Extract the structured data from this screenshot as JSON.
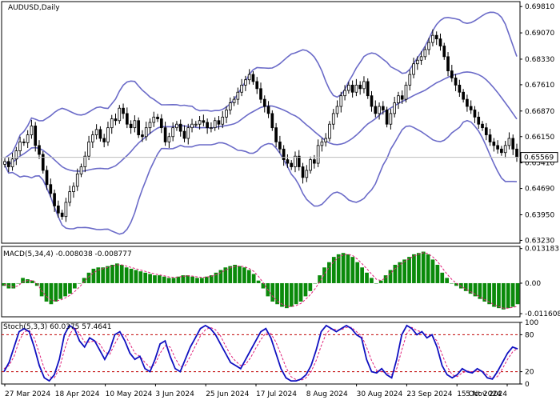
{
  "window_title": "AUDUSD,Daily",
  "colors": {
    "up": "#000000",
    "down": "#000000",
    "bollinger": "#6b6bc8",
    "macd_hist": "#0a8a0a",
    "macd_signal": "#e0207a",
    "stoch_main": "#1010c0",
    "stoch_signal": "#e0207a",
    "grid_level": "#c00000",
    "price_line": "#bdbdbd"
  },
  "chart_data": [
    {
      "type": "candlestick",
      "title": "AUDUSD,Daily",
      "panel": "main",
      "ylim": [
        0.6315,
        0.6995
      ],
      "y_ticks": [
        "0.69810",
        "0.69070",
        "0.68330",
        "0.67610",
        "0.66870",
        "0.66150",
        "0.65410",
        "0.64690",
        "0.63950",
        "0.63230"
      ],
      "current_price": "0.65569",
      "closes": [
        0.6545,
        0.653,
        0.6552,
        0.6575,
        0.66,
        0.6598,
        0.662,
        0.6645,
        0.659,
        0.6565,
        0.652,
        0.648,
        0.6455,
        0.642,
        0.64,
        0.639,
        0.643,
        0.646,
        0.6475,
        0.651,
        0.653,
        0.656,
        0.66,
        0.662,
        0.6635,
        0.661,
        0.66,
        0.664,
        0.6665,
        0.666,
        0.6695,
        0.668,
        0.665,
        0.664,
        0.666,
        0.662,
        0.6615,
        0.664,
        0.6655,
        0.667,
        0.6665,
        0.664,
        0.66,
        0.6615,
        0.664,
        0.665,
        0.663,
        0.661,
        0.664,
        0.665,
        0.665,
        0.666,
        0.6655,
        0.664,
        0.664,
        0.666,
        0.665,
        0.667,
        0.669,
        0.671,
        0.672,
        0.674,
        0.676,
        0.6775,
        0.679,
        0.677,
        0.675,
        0.672,
        0.67,
        0.668,
        0.664,
        0.66,
        0.658,
        0.655,
        0.654,
        0.653,
        0.656,
        0.653,
        0.65,
        0.652,
        0.655,
        0.654,
        0.659,
        0.66,
        0.661,
        0.665,
        0.668,
        0.67,
        0.673,
        0.6745,
        0.676,
        0.674,
        0.676,
        0.675,
        0.677,
        0.673,
        0.67,
        0.668,
        0.67,
        0.669,
        0.665,
        0.668,
        0.671,
        0.673,
        0.672,
        0.676,
        0.679,
        0.682,
        0.683,
        0.684,
        0.686,
        0.688,
        0.69,
        0.689,
        0.687,
        0.684,
        0.68,
        0.678,
        0.676,
        0.674,
        0.672,
        0.67,
        0.669,
        0.667,
        0.665,
        0.664,
        0.662,
        0.66,
        0.659,
        0.658,
        0.657,
        0.659,
        0.661,
        0.658,
        0.6557
      ],
      "x_labels": [
        "27 Mar 2024",
        "18 Apr 2024",
        "10 May 2024",
        "3 Jun 2024",
        "25 Jun 2024",
        "17 Jul 2024",
        "8 Aug 2024",
        "30 Aug 2024",
        "23 Sep 2024",
        "15 Oct 2024",
        "5 Nov 2024"
      ]
    },
    {
      "type": "bar",
      "title": "MACD(5,34,4) -0.008038 -0.008777",
      "panel": "macd",
      "ylim": [
        -0.0128,
        0.014
      ],
      "y_ticks": [
        "0.013183",
        "0.00",
        "-0.011608"
      ],
      "values": [
        -0.001,
        -0.002,
        -0.002,
        0.0,
        0.002,
        0.0015,
        0.001,
        -0.001,
        -0.005,
        -0.007,
        -0.008,
        -0.007,
        -0.006,
        -0.005,
        -0.004,
        -0.002,
        0.0,
        0.002,
        0.004,
        0.0055,
        0.006,
        0.006,
        0.0065,
        0.007,
        0.0075,
        0.007,
        0.006,
        0.0055,
        0.005,
        0.0045,
        0.004,
        0.0035,
        0.003,
        0.003,
        0.0025,
        0.002,
        0.002,
        0.0025,
        0.003,
        0.003,
        0.0025,
        0.002,
        0.002,
        0.0025,
        0.003,
        0.004,
        0.005,
        0.006,
        0.0065,
        0.007,
        0.0065,
        0.006,
        0.005,
        0.0035,
        0.001,
        -0.002,
        -0.005,
        -0.007,
        -0.008,
        -0.009,
        -0.0095,
        -0.009,
        -0.008,
        -0.007,
        -0.005,
        -0.003,
        0.0,
        0.003,
        0.006,
        0.008,
        0.01,
        0.011,
        0.0115,
        0.011,
        0.01,
        0.008,
        0.006,
        0.004,
        0.002,
        0.0,
        0.001,
        0.003,
        0.005,
        0.007,
        0.008,
        0.009,
        0.01,
        0.011,
        0.0115,
        0.012,
        0.011,
        0.009,
        0.007,
        0.004,
        0.002,
        0.0,
        -0.001,
        -0.002,
        -0.003,
        -0.004,
        -0.005,
        -0.006,
        -0.007,
        -0.008,
        -0.009,
        -0.0095,
        -0.01,
        -0.0095,
        -0.009,
        -0.008
      ],
      "signal": [
        -0.0005,
        -0.001,
        -0.0015,
        -0.001,
        0.0005,
        0.001,
        0.001,
        0.0,
        -0.003,
        -0.005,
        -0.0065,
        -0.0068,
        -0.0064,
        -0.0056,
        -0.0046,
        -0.0032,
        -0.0015,
        0.0005,
        0.0025,
        0.004,
        0.005,
        0.0055,
        0.006,
        0.0065,
        0.007,
        0.007,
        0.0065,
        0.006,
        0.0055,
        0.005,
        0.0045,
        0.004,
        0.0035,
        0.0032,
        0.0028,
        0.0024,
        0.0022,
        0.0023,
        0.0026,
        0.0028,
        0.0027,
        0.0024,
        0.0022,
        0.0023,
        0.0026,
        0.0032,
        0.004,
        0.005,
        0.0058,
        0.0064,
        0.0065,
        0.0063,
        0.0056,
        0.0045,
        0.0026,
        0.0002,
        -0.0025,
        -0.005,
        -0.0068,
        -0.008,
        -0.0088,
        -0.0089,
        -0.0085,
        -0.0077,
        -0.0062,
        -0.0044,
        -0.0022,
        0.0005,
        0.0035,
        0.006,
        0.0082,
        0.0098,
        0.0108,
        0.011,
        0.0105,
        0.0092,
        0.0074,
        0.0055,
        0.0035,
        0.0015,
        0.001,
        0.002,
        0.0037,
        0.0055,
        0.007,
        0.0082,
        0.0093,
        0.0103,
        0.011,
        0.0116,
        0.0113,
        0.01,
        0.0083,
        0.0058,
        0.0035,
        0.0015,
        0.0,
        -0.0012,
        -0.0022,
        -0.0032,
        -0.0042,
        -0.0052,
        -0.0062,
        -0.0072,
        -0.0082,
        -0.0089,
        -0.0095,
        -0.0095,
        -0.0092,
        -0.0088
      ]
    },
    {
      "type": "line",
      "title": "Stoch(5,3,3) 60.0375 57.4641",
      "panel": "stoch",
      "ylim": [
        0,
        100
      ],
      "levels": [
        80,
        20
      ],
      "y_ticks": [
        "100",
        "80",
        "20",
        "0"
      ],
      "series": [
        {
          "values": [
            20,
            35,
            60,
            85,
            90,
            85,
            60,
            30,
            10,
            5,
            15,
            40,
            80,
            95,
            90,
            70,
            60,
            75,
            70,
            55,
            40,
            55,
            80,
            85,
            70,
            50,
            40,
            45,
            25,
            20,
            40,
            65,
            70,
            45,
            25,
            20,
            40,
            60,
            75,
            90,
            95,
            90,
            80,
            65,
            50,
            35,
            30,
            25,
            40,
            55,
            70,
            85,
            90,
            75,
            50,
            25,
            10,
            5,
            5,
            8,
            15,
            30,
            55,
            85,
            95,
            90,
            85,
            90,
            95,
            90,
            80,
            75,
            40,
            20,
            18,
            25,
            15,
            10,
            40,
            80,
            95,
            90,
            80,
            85,
            75,
            80,
            60,
            30,
            15,
            10,
            15,
            25,
            20,
            18,
            25,
            20,
            10,
            8,
            20,
            35,
            50,
            60,
            57
          ]
        },
        {
          "values": [
            25,
            30,
            45,
            70,
            85,
            87,
            75,
            50,
            25,
            12,
            10,
            25,
            55,
            80,
            92,
            82,
            68,
            68,
            70,
            65,
            52,
            48,
            65,
            80,
            80,
            65,
            50,
            45,
            35,
            27,
            32,
            50,
            62,
            60,
            42,
            28,
            30,
            45,
            62,
            78,
            88,
            92,
            88,
            78,
            62,
            47,
            37,
            30,
            32,
            43,
            58,
            72,
            83,
            82,
            68,
            48,
            27,
            12,
            7,
            6,
            10,
            20,
            38,
            62,
            82,
            90,
            88,
            88,
            92,
            92,
            85,
            78,
            60,
            38,
            22,
            20,
            18,
            15,
            25,
            55,
            82,
            92,
            87,
            84,
            80,
            78,
            70,
            48,
            28,
            15,
            12,
            18,
            21,
            20,
            21,
            21,
            15,
            10,
            12,
            25,
            40,
            52,
            58
          ]
        }
      ]
    }
  ]
}
